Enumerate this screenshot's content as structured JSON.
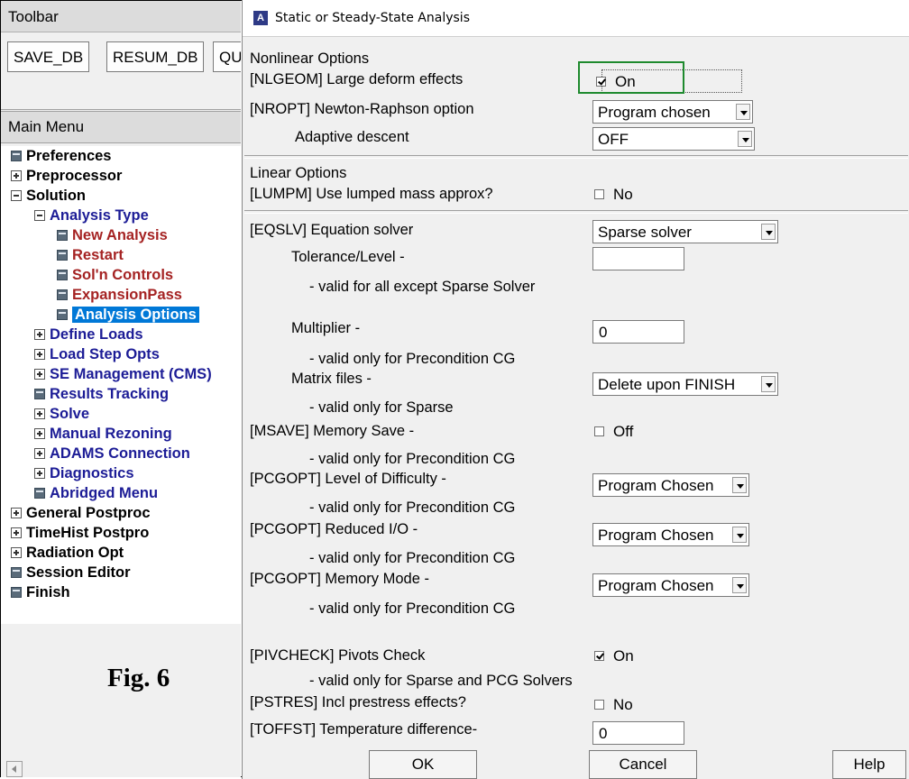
{
  "toolbar": {
    "title": "Toolbar",
    "buttons": [
      "SAVE_DB",
      "RESUM_DB",
      "QU"
    ]
  },
  "main_menu": {
    "title": "Main Menu",
    "items": [
      {
        "label": "Preferences",
        "icon": "leaf-icon"
      },
      {
        "label": "Preprocessor",
        "icon": "expand-icon"
      },
      {
        "label": "Solution",
        "icon": "collapse-icon"
      },
      {
        "label": "Analysis Type",
        "icon": "collapse-icon"
      },
      {
        "label": "New Analysis",
        "icon": "leaf-icon"
      },
      {
        "label": "Restart",
        "icon": "leaf-icon"
      },
      {
        "label": "Sol'n Controls",
        "icon": "leaf-icon"
      },
      {
        "label": "ExpansionPass",
        "icon": "leaf-icon"
      },
      {
        "label": "Analysis Options",
        "icon": "leaf-icon",
        "selected": true
      },
      {
        "label": "Define Loads",
        "icon": "expand-icon"
      },
      {
        "label": "Load Step Opts",
        "icon": "expand-icon"
      },
      {
        "label": "SE Management (CMS)",
        "icon": "expand-icon"
      },
      {
        "label": "Results Tracking",
        "icon": "leaf-icon"
      },
      {
        "label": "Solve",
        "icon": "expand-icon"
      },
      {
        "label": "Manual Rezoning",
        "icon": "expand-icon"
      },
      {
        "label": "ADAMS Connection",
        "icon": "expand-icon"
      },
      {
        "label": "Diagnostics",
        "icon": "expand-icon"
      },
      {
        "label": "Abridged Menu",
        "icon": "leaf-icon"
      },
      {
        "label": "General Postproc",
        "icon": "expand-icon"
      },
      {
        "label": "TimeHist Postpro",
        "icon": "expand-icon"
      },
      {
        "label": "Radiation Opt",
        "icon": "expand-icon"
      },
      {
        "label": "Session Editor",
        "icon": "leaf-icon"
      },
      {
        "label": "Finish",
        "icon": "leaf-icon"
      }
    ]
  },
  "figure_label": "Fig. 6",
  "dialog": {
    "title": "Static or Steady-State Analysis",
    "nonlinear_header": "Nonlinear Options",
    "nlgeom_label": "[NLGEOM]  Large deform effects",
    "nlgeom_value": "On",
    "nlgeom_checked": true,
    "nropt_label": "[NROPT]  Newton-Raphson option",
    "nropt_value": "Program chosen",
    "adaptive_label": "Adaptive descent",
    "adaptive_value": "OFF",
    "linear_header": "Linear Options",
    "lumpm_label": "[LUMPM] Use lumped mass approx?",
    "lumpm_value": "No",
    "lumpm_checked": false,
    "eqslv_label": "[EQSLV]  Equation solver",
    "eqslv_value": "Sparse solver",
    "tolerance_label": "Tolerance/Level -",
    "tolerance_value": "",
    "tolerance_note": "- valid for all except Sparse Solver",
    "multiplier_label": "Multiplier -",
    "multiplier_value": "0",
    "multiplier_note": "- valid only for Precondition CG",
    "matrix_label": "Matrix files -",
    "matrix_value": "Delete upon FINISH",
    "matrix_note": "- valid only for Sparse",
    "msave_label": "[MSAVE]   Memory Save -",
    "msave_value": "Off",
    "msave_checked": false,
    "msave_note": "- valid only for Precondition CG",
    "pcgopt_level_label": "[PCGOPT]  Level of Difficulty -",
    "pcgopt_level_value": "Program Chosen",
    "pcgopt_level_note": "- valid only for Precondition CG",
    "pcgopt_io_label": "[PCGOPT]  Reduced I/O -",
    "pcgopt_io_value": "Program Chosen",
    "pcgopt_io_note": "- valid only for Precondition CG",
    "pcgopt_mem_label": "[PCGOPT]  Memory Mode -",
    "pcgopt_mem_value": "Program Chosen",
    "pcgopt_mem_note": "- valid only for Precondition CG",
    "pivcheck_label": "[PIVCHECK] Pivots Check",
    "pivcheck_value": "On",
    "pivcheck_checked": true,
    "pivcheck_note": "- valid only for Sparse and PCG Solvers",
    "pstres_label": "[PSTRES] Incl prestress effects?",
    "pstres_value": "No",
    "pstres_checked": false,
    "toffst_label": "[TOFFST] Temperature difference-",
    "toffst_value": "0",
    "ok_label": "OK",
    "cancel_label": "Cancel",
    "help_label": "Help"
  },
  "colors": {
    "selection": "#0078d7",
    "highlight_box": "#1e8a2e",
    "tree_navy": "#1c1c96",
    "tree_red": "#a52323"
  }
}
